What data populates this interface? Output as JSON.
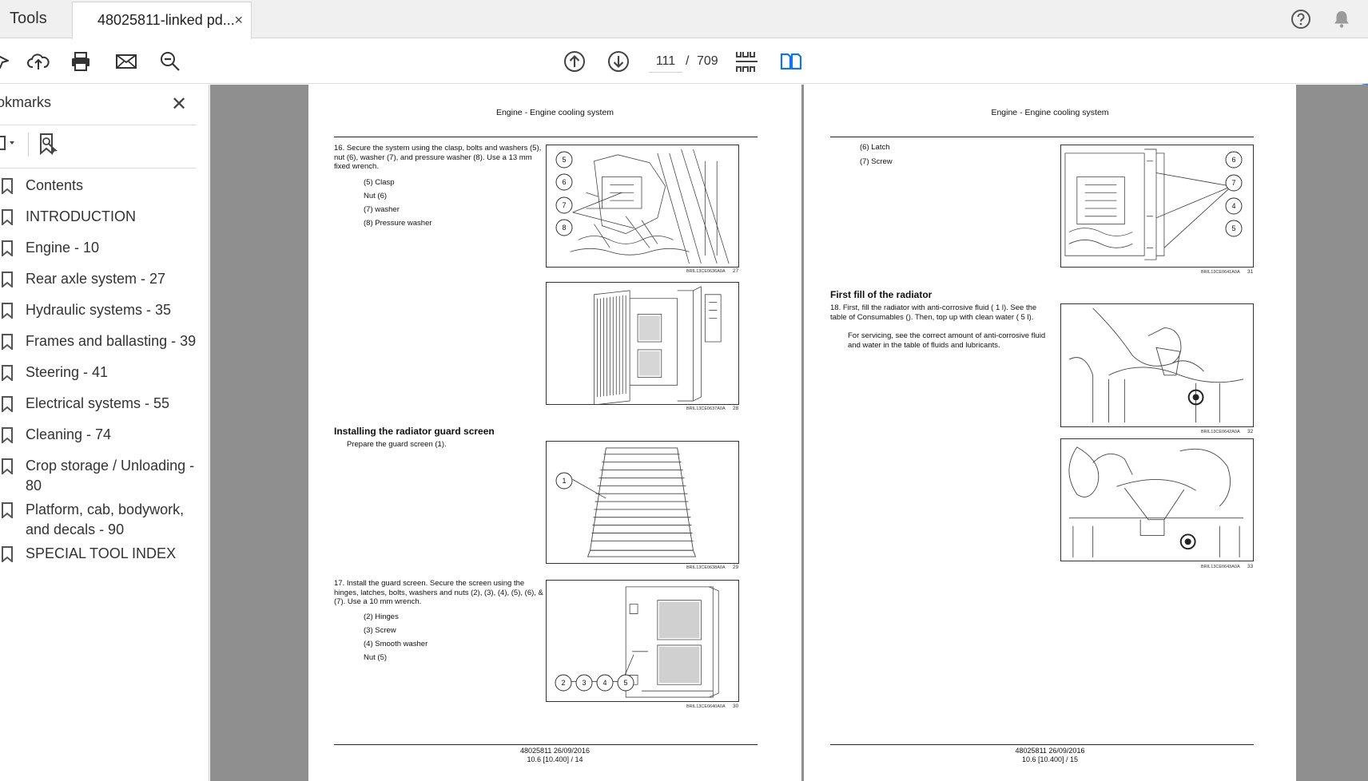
{
  "tabs": {
    "tools": "Tools",
    "document": "48025811-linked pd...",
    "close": "×"
  },
  "toolbar": {
    "page_current": "111",
    "page_separator": "/",
    "page_total": "709"
  },
  "sidebar": {
    "title": "okmarks",
    "close": "✕",
    "items": [
      {
        "label": "Contents"
      },
      {
        "label": "INTRODUCTION"
      },
      {
        "label": "Engine - 10"
      },
      {
        "label": "Rear axle system - 27"
      },
      {
        "label": "Hydraulic systems - 35"
      },
      {
        "label": "Frames and ballasting - 39"
      },
      {
        "label": "Steering - 41"
      },
      {
        "label": "Electrical systems - 55"
      },
      {
        "label": "Cleaning - 74"
      },
      {
        "label": "Crop storage / Unloading - 80"
      },
      {
        "label": "Platform, cab, bodywork, and decals - 90"
      },
      {
        "label": "SPECIAL TOOL INDEX"
      }
    ]
  },
  "left_page": {
    "header": "Engine - Engine cooling system",
    "step16": "16.   Secure the system using the clasp, bolts and washers (5), nut (6), washer (7), and pressure washer (8). Use a 13 mm fixed wrench.",
    "step16_items": [
      "(5) Clasp",
      "Nut (6)",
      "(7) washer",
      "(8) Pressure washer"
    ],
    "fig27_code": "BRIL13CE0636A0A",
    "fig27_num": "27",
    "fig28_code": "BRIL13CE0637A0A",
    "fig28_num": "28",
    "heading_guard": "Installing the radiator guard screen",
    "prepare": "Prepare the guard screen (1).",
    "fig29_code": "BRIL13CE0638A0A",
    "fig29_num": "29",
    "step17": "17.   Install the guard screen. Secure the screen using the hinges, latches, bolts, washers and nuts (2), (3), (4), (5), (6), & (7).  Use a 10 mm wrench.",
    "step17_items": [
      "(2) Hinges",
      "(3) Screw",
      "(4) Smooth washer",
      "Nut (5)"
    ],
    "fig30_code": "BRIL13CE0640A0A",
    "fig30_num": "30",
    "footer_line1": "48025811 26/09/2016",
    "footer_line2": "10.6 [10.400] / 14",
    "callouts27": [
      "5",
      "6",
      "7",
      "8"
    ],
    "callouts29": [
      "1"
    ],
    "callouts30": [
      "2",
      "3",
      "4",
      "5"
    ]
  },
  "right_page": {
    "header": "Engine - Engine cooling system",
    "items": [
      "(6) Latch",
      "(7) Screw"
    ],
    "fig31_code": "BRIL13CE0641A0A",
    "fig31_num": "31",
    "callouts31": [
      "6",
      "7",
      "4",
      "5"
    ],
    "heading_fill": "First fill of the radiator",
    "step18": "18.   First, fill the radiator with anti-corrosive fluid ( 1 l). See the table of Consumables (). Then, top up with clean water ( 5 l).",
    "step18b": "For servicing, see the correct amount of anti-corrosive fluid and water in the table of fluids and lubricants.",
    "fig32_code": "BRIL13CE0642A0A",
    "fig32_num": "32",
    "fig33_code": "BRIL13CE0643A0A",
    "fig33_num": "33",
    "footer_line1": "48025811 26/09/2016",
    "footer_line2": "10.6 [10.400] / 15"
  },
  "icons": [
    "pointer-icon",
    "upload-icon",
    "print-icon",
    "mail-icon",
    "zoom-icon",
    "page-up-icon",
    "page-down-icon",
    "page-thumbnails-icon",
    "two-page-view-icon",
    "help-icon",
    "bell-icon",
    "bookmark-icon",
    "bookmark-options-icon",
    "find-bookmark-icon"
  ],
  "colors": {
    "accent": "#1473e6",
    "doc_background": "#8f8f8f"
  }
}
